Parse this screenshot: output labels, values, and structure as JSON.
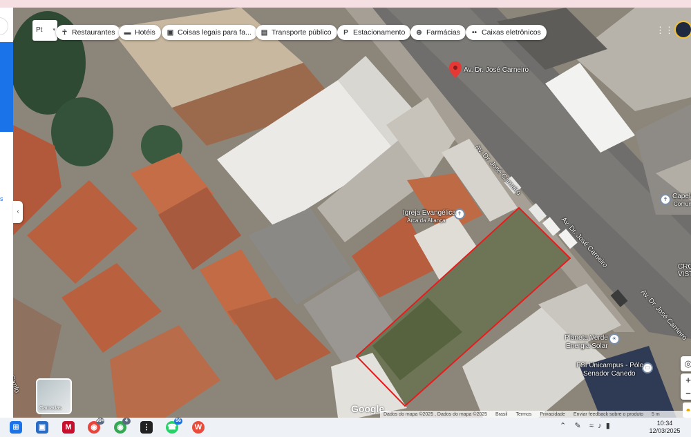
{
  "lang_selector": {
    "label": "Pt"
  },
  "chips": [
    {
      "icon": "fork-knife-icon",
      "glyph": "☥",
      "label": "Restaurantes"
    },
    {
      "icon": "bed-icon",
      "glyph": "▬",
      "label": "Hotéis"
    },
    {
      "icon": "camera-icon",
      "glyph": "▣",
      "label": "Coisas legais para fa..."
    },
    {
      "icon": "bus-icon",
      "glyph": "▤",
      "label": "Transporte público"
    },
    {
      "icon": "parking-icon",
      "glyph": "P",
      "label": "Estacionamento"
    },
    {
      "icon": "pharmacy-icon",
      "glyph": "⊕",
      "label": "Farmácias"
    },
    {
      "icon": "atm-icon",
      "glyph": "••",
      "label": "Caixas eletrônicos"
    }
  ],
  "map": {
    "pin_label": "Av. Dr. José Carneiro",
    "street_labels": [
      "Av. Dr. José Carneiro",
      "Av. Dr. José Carneiro",
      "Av. Dr. José Carneiro",
      "o Sanfo"
    ],
    "poi_church_name": "Igreja Evangélica",
    "poi_church_sub": "Arca da Aliança",
    "poi_solar_name": "Planeta Verde",
    "poi_solar_sub": "Energia Solar",
    "poi_school_name": "FSI Unicampus - Pólo",
    "poi_school_sub": "Senador Canedo",
    "poi_right_name": "Capela",
    "poi_right_sub": "Comunitária",
    "poi_right2": "CRO",
    "poi_right3": "VISTO",
    "camadas_label": "Camadas",
    "google_label": "Google",
    "highlight_color": "#e41d1d"
  },
  "attribution": {
    "data": "Dados do mapa ©2025 , Dados do mapa ©2025",
    "country": "Brasil",
    "terms": "Termos",
    "privacy": "Privacidade",
    "feedback": "Enviar feedback sobre o produto",
    "scale": "5 m"
  },
  "taskbar": {
    "time": "10:34",
    "date": "12/03/2025",
    "badge_1": "99+",
    "badge_2": "4",
    "badge_whatsapp": "56"
  }
}
